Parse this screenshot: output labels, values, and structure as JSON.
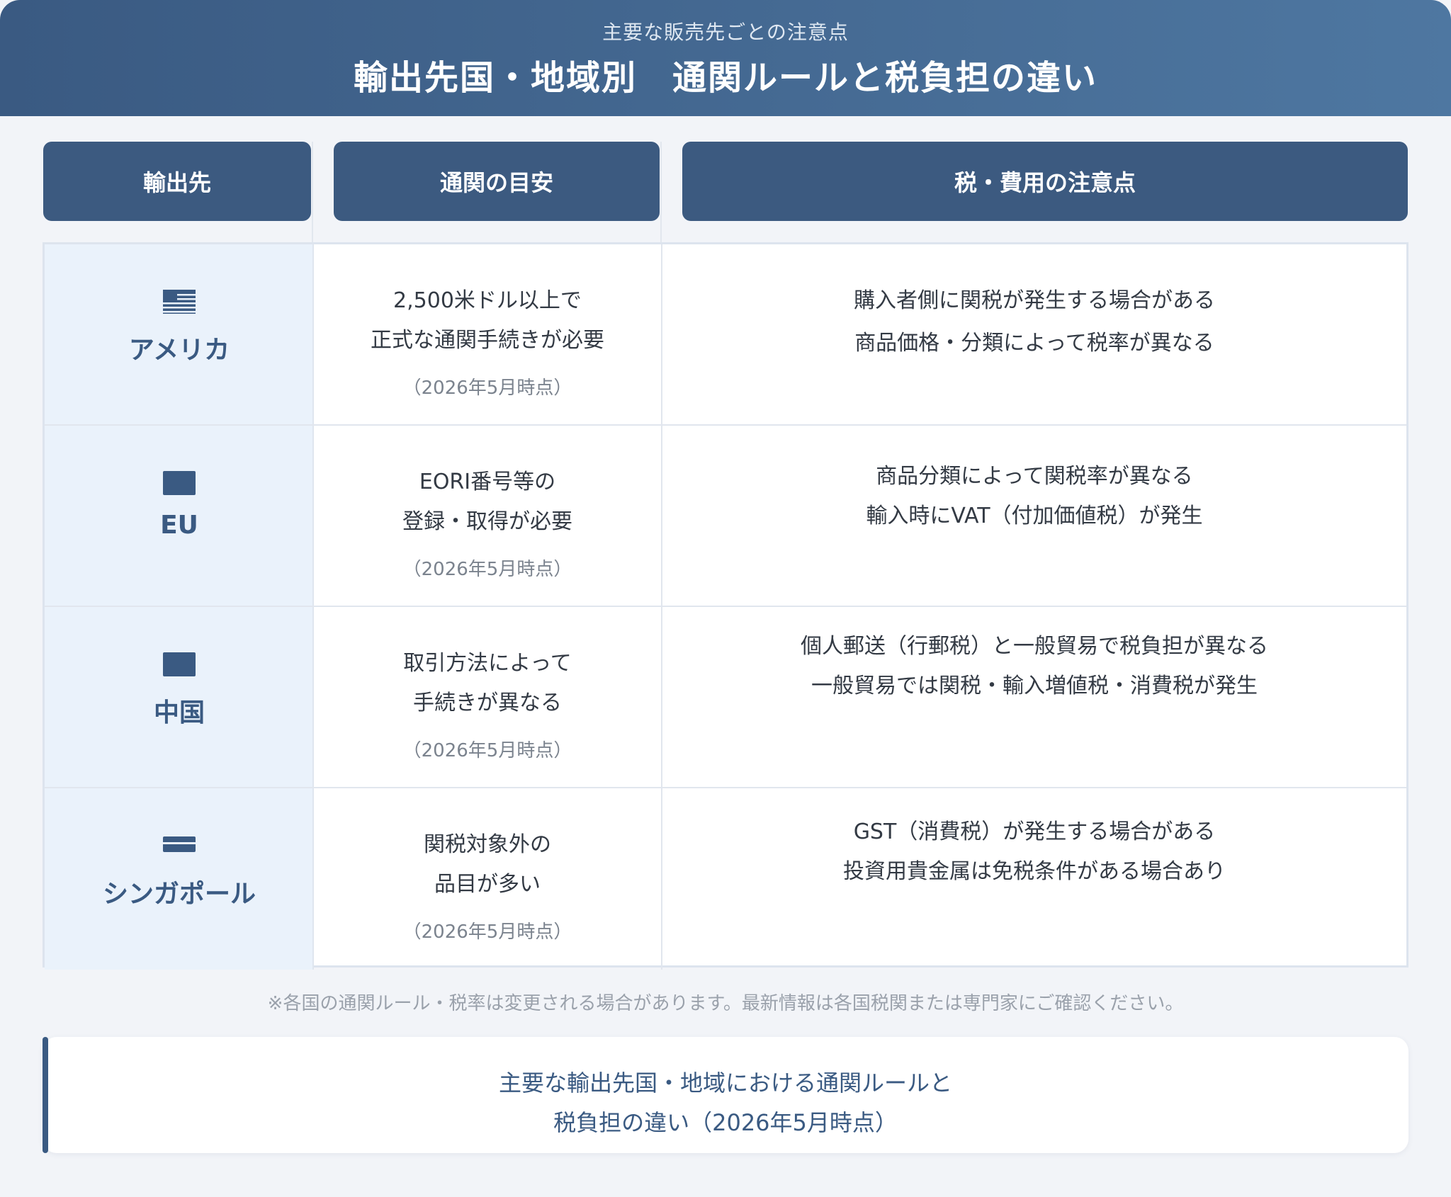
{
  "header": {
    "subtitle": "主要な販売先ごとの注意点",
    "title": "輸出先国・地域別　通関ルールと税負担の違い"
  },
  "columns": {
    "destination": "輸出先",
    "customs": "通関の目安",
    "tax": "税・費用の注意点"
  },
  "rows": [
    {
      "flag_icon": "us-flag-icon",
      "country": "アメリカ",
      "customs_lines": [
        "2,500米ドル以上で",
        "正式な通関手続きが必要"
      ],
      "as_of": "（2026年5月時点）",
      "tax_lines": [
        "購入者側に関税が発生する場合がある",
        "商品価格・分類によって税率が異なる"
      ]
    },
    {
      "flag_icon": "eu-flag-icon",
      "country": "EU",
      "customs_lines": [
        "EORI番号等の",
        "登録・取得が必要"
      ],
      "as_of": "（2026年5月時点）",
      "tax_lines": [
        "商品分類によって関税率が異なる",
        "輸入時にVAT（付加価値税）が発生"
      ]
    },
    {
      "flag_icon": "china-flag-icon",
      "country": "中国",
      "customs_lines": [
        "取引方法によって",
        "手続きが異なる"
      ],
      "as_of": "（2026年5月時点）",
      "tax_lines": [
        "個人郵送（行郵税）と一般貿易で税負担が異なる",
        "一般貿易では関税・輸入増値税・消費税が発生"
      ]
    },
    {
      "flag_icon": "singapore-flag-icon",
      "country": "シンガポール",
      "customs_lines": [
        "関税対象外の",
        "品目が多い"
      ],
      "as_of": "（2026年5月時点）",
      "tax_lines": [
        "GST（消費税）が発生する場合がある",
        "投資用貴金属は免税条件がある場合あり"
      ]
    }
  ],
  "note": "※各国の通関ルール・税率は変更される場合があります。最新情報は各国税関または専門家にご確認ください。",
  "caption": {
    "line1": "主要な輸出先国・地域における通関ルールと",
    "line2": "税負担の違い（2026年5月時点）"
  },
  "colors": {
    "header_start": "#3a5a82",
    "header_end": "#4e77a1",
    "column_header": "#3c5a80",
    "country_cell": "#eaf2fb",
    "accent_text": "#3a5a82"
  }
}
